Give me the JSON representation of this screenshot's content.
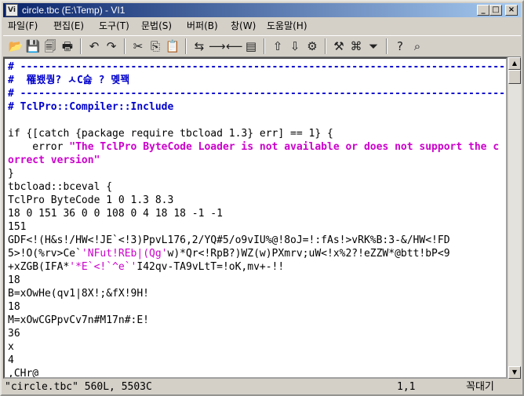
{
  "window": {
    "app_icon_text": "Vi",
    "title": "circle.tbc (E:\\Temp) - VI1",
    "minimize_glyph": "_",
    "maximize_glyph": "□",
    "close_glyph": "×"
  },
  "menu": [
    {
      "label": "파일(F)"
    },
    {
      "label": "편집(E)"
    },
    {
      "label": "도구(T)"
    },
    {
      "label": "문법(S)"
    },
    {
      "label": "버퍼(B)"
    },
    {
      "label": "창(W)"
    },
    {
      "label": "도움말(H)"
    }
  ],
  "toolbar": [
    {
      "name": "open-icon",
      "glyph": "📂"
    },
    {
      "name": "save-icon",
      "glyph": "💾"
    },
    {
      "name": "save-all-icon",
      "glyph": "🗐"
    },
    {
      "name": "print-icon",
      "glyph": "🖶"
    },
    {
      "name": "undo-icon",
      "glyph": "↶"
    },
    {
      "name": "redo-icon",
      "glyph": "↷"
    },
    {
      "name": "cut-icon",
      "glyph": "✂"
    },
    {
      "name": "copy-icon",
      "glyph": "⎘"
    },
    {
      "name": "paste-icon",
      "glyph": "📋"
    },
    {
      "name": "find-replace-icon",
      "glyph": "⇆"
    },
    {
      "name": "find-next-icon",
      "glyph": "⟶"
    },
    {
      "name": "find-prev-icon",
      "glyph": "⟵"
    },
    {
      "name": "load-session-icon",
      "glyph": "▤"
    },
    {
      "name": "upload-icon",
      "glyph": "⇧"
    },
    {
      "name": "download-icon",
      "glyph": "⇩"
    },
    {
      "name": "run-script-icon",
      "glyph": "⚙"
    },
    {
      "name": "make-icon",
      "glyph": "⚒"
    },
    {
      "name": "shell-icon",
      "glyph": "⌘"
    },
    {
      "name": "tag-icon",
      "glyph": "⏷"
    },
    {
      "name": "help-icon",
      "glyph": "?"
    },
    {
      "name": "find-help-icon",
      "glyph": "⌕"
    }
  ],
  "editor_lines": [
    [
      {
        "c": "cm",
        "t": "# ----------------------------------------------------------------------------------"
      }
    ],
    [
      {
        "c": "cm",
        "t": "#  罹뵀퀑? ㅅC슳 ? 몢꽥"
      }
    ],
    [
      {
        "c": "cm",
        "t": "# ----------------------------------------------------------------------------------"
      }
    ],
    [
      {
        "c": "cm",
        "t": "# TclPro::Compiler::Include"
      }
    ],
    [
      {
        "c": "tx",
        "t": ""
      }
    ],
    [
      {
        "c": "tx",
        "t": "if {[catch {package require tbcload 1.3} err] == 1} {"
      }
    ],
    [
      {
        "c": "tx",
        "t": "    error "
      },
      {
        "c": "st",
        "t": "\"The TclPro ByteCode Loader is not available or does not support the c"
      }
    ],
    [
      {
        "c": "st",
        "t": "orrect version\""
      }
    ],
    [
      {
        "c": "tx",
        "t": "}"
      }
    ],
    [
      {
        "c": "tx",
        "t": "tbcload::bceval {"
      }
    ],
    [
      {
        "c": "tx",
        "t": "TclPro ByteCode 1 0 1.3 8.3"
      }
    ],
    [
      {
        "c": "tx",
        "t": "18 0 151 36 0 0 108 0 4 18 18 -1 -1"
      }
    ],
    [
      {
        "c": "tx",
        "t": "151"
      }
    ],
    [
      {
        "c": "tx",
        "t": "GDF<!(H&s!/HW<!JE`<!3)PpvL176,2/YQ#5/o9vIU%@!8oJ=!:fAs!>vRK%B:3-&/HW<!FD"
      }
    ],
    [
      {
        "c": "tx",
        "t": "5>!O(%rv>Ce`"
      },
      {
        "c": "mg",
        "t": "'NFut!REb|(Qg'"
      },
      {
        "c": "tx",
        "t": "w)*Qr<!RpB?)WZ(w)PXmrv;uW<!x%2?!eZZW*@btt!bP<9"
      }
    ],
    [
      {
        "c": "tx",
        "t": "+xZGB(IFA*"
      },
      {
        "c": "mg",
        "t": "'*E`<!`^e`'"
      },
      {
        "c": "tx",
        "t": "I42qv-TA9vLtT=!oK,mv+-!!"
      }
    ],
    [
      {
        "c": "tx",
        "t": "18"
      }
    ],
    [
      {
        "c": "tx",
        "t": "B=xOwHe(qv1|8X!;&fX!9H!"
      }
    ],
    [
      {
        "c": "tx",
        "t": "18"
      }
    ],
    [
      {
        "c": "tx",
        "t": "M=xOwCGPpvCv7n#M17n#:E!"
      }
    ],
    [
      {
        "c": "tx",
        "t": "36"
      }
    ],
    [
      {
        "c": "tx",
        "t": "x"
      }
    ],
    [
      {
        "c": "tx",
        "t": "4"
      }
    ],
    [
      {
        "c": "tx",
        "t": ",CHr@"
      }
    ]
  ],
  "status": {
    "file_info": "\"circle.tbc\" 560L, 5503C",
    "cursor_pos": "1,1",
    "mode": "꼭대기"
  },
  "scrollbar": {
    "up_glyph": "▲",
    "down_glyph": "▼"
  }
}
